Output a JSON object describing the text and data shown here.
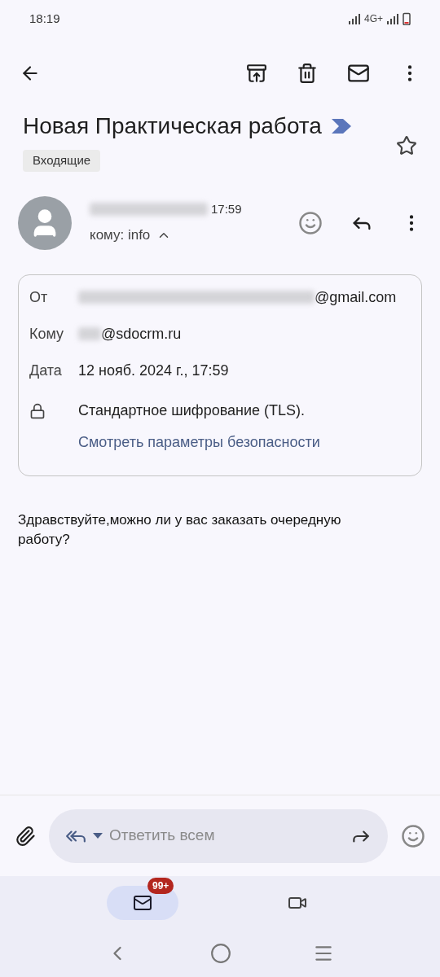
{
  "status_bar": {
    "time": "18:19",
    "network": "4G+"
  },
  "subject": {
    "title": "Новая Практическая работа",
    "label": "Входящие",
    "starred": false
  },
  "sender": {
    "time": "17:59",
    "to_line": "кому: info",
    "expanded": true
  },
  "details": [
    {
      "kind": "from",
      "label": "От",
      "value": "@gmail.com",
      "redacted": true
    },
    {
      "kind": "to",
      "label": "Кому",
      "value": "@sdocrm.ru",
      "redacted": true
    },
    {
      "kind": "date",
      "label": "Дата",
      "value": "12 нояб. 2024 г., 17:59",
      "redacted": false
    },
    {
      "kind": "security",
      "value": "Стандартное шифрование (TLS).",
      "link": "Смотреть параметры безопасности"
    }
  ],
  "body": "Здравствуйте,можно ли у вас заказать очередную работу?",
  "reply": {
    "placeholder": "Ответить всем"
  },
  "bottom_nav": [
    {
      "kind": "mail",
      "badge": "99+",
      "selected": true
    },
    {
      "kind": "video",
      "selected": false
    }
  ]
}
